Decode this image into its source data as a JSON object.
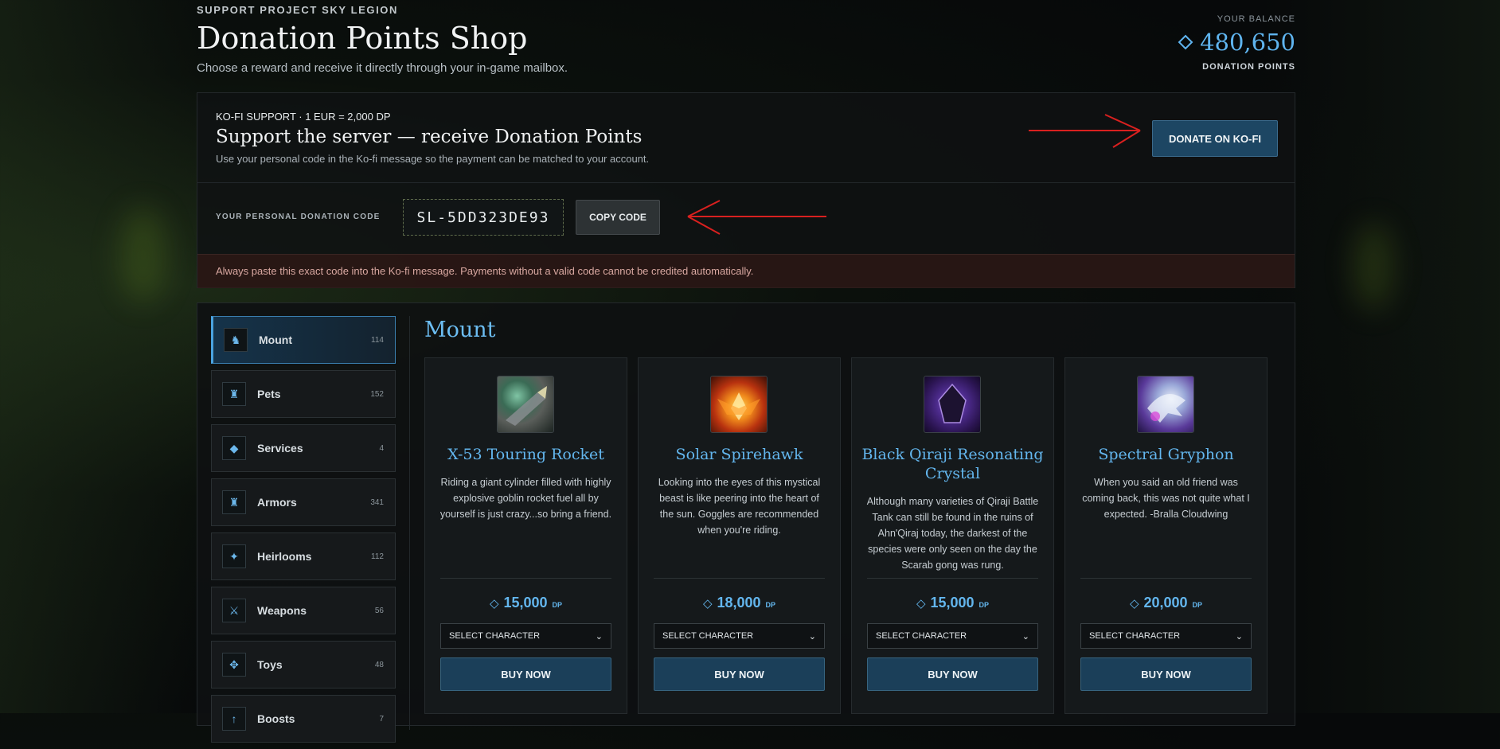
{
  "header": {
    "kicker": "SUPPORT PROJECT SKY LEGION",
    "title": "Donation Points Shop",
    "subtitle": "Choose a reward and receive it directly through your in-game mailbox."
  },
  "balance": {
    "label": "YOUR BALANCE",
    "icon": "diamond-icon",
    "value": "480,650",
    "unit": "DONATION POINTS"
  },
  "kofi": {
    "kicker": "KO-FI SUPPORT · 1 EUR = 2,000 DP",
    "title": "Support the server — receive Donation Points",
    "note": "Use your personal code in the Ko-fi message so the payment can be matched to your account.",
    "donate_label": "DONATE ON KO-FI",
    "code_label": "YOUR PERSONAL DONATION CODE",
    "code": "SL-5DD323DE93",
    "copy_label": "COPY CODE",
    "warning": "Always paste this exact code into the Ko-fi message. Payments without a valid code cannot be credited automatically."
  },
  "colors": {
    "accent": "#5fb4ef",
    "button": "#1d4663",
    "arrow": "#d9201f"
  },
  "categories": [
    {
      "name": "Mount",
      "count": "114",
      "icon": "horse-icon",
      "active": true
    },
    {
      "name": "Pets",
      "count": "152",
      "icon": "pet-icon"
    },
    {
      "name": "Services",
      "count": "4",
      "icon": "diamond-icon"
    },
    {
      "name": "Armors",
      "count": "341",
      "icon": "armor-icon"
    },
    {
      "name": "Heirlooms",
      "count": "112",
      "icon": "star-icon"
    },
    {
      "name": "Weapons",
      "count": "56",
      "icon": "swords-icon"
    },
    {
      "name": "Toys",
      "count": "48",
      "icon": "move-icon"
    },
    {
      "name": "Boosts",
      "count": "7",
      "icon": "arrow-up-icon"
    }
  ],
  "section_title": "Mount",
  "items": [
    {
      "name": "X-53 Touring Rocket",
      "description": "Riding a giant cylinder filled with highly explosive goblin rocket fuel all by yourself is just crazy...so bring a friend.",
      "price": "15,000",
      "price_unit": "DP",
      "select": "SELECT CHARACTER",
      "buy": "BUY NOW",
      "icon": "rocket-icon"
    },
    {
      "name": "Solar Spirehawk",
      "description": "Looking into the eyes of this mystical beast is like peering into the heart of the sun. Goggles are recommended when you're riding.",
      "price": "18,000",
      "price_unit": "DP",
      "select": "SELECT CHARACTER",
      "buy": "BUY NOW",
      "icon": "phoenix-icon"
    },
    {
      "name": "Black Qiraji Resonating Crystal",
      "description": "Although many varieties of Qiraji Battle Tank can still be found in the ruins of Ahn'Qiraj today, the darkest of the species were only seen on the day the Scarab gong was rung.",
      "price": "15,000",
      "price_unit": "DP",
      "select": "SELECT CHARACTER",
      "buy": "BUY NOW",
      "icon": "crystal-icon"
    },
    {
      "name": "Spectral Gryphon",
      "description": "When you said an old friend was coming back, this was not quite what I expected. -Bralla Cloudwing",
      "price": "20,000",
      "price_unit": "DP",
      "select": "SELECT CHARACTER",
      "buy": "BUY NOW",
      "icon": "gryphon-icon"
    }
  ]
}
